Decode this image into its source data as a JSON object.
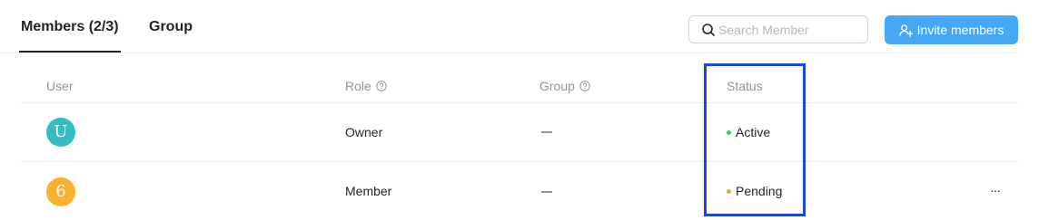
{
  "tabs": [
    {
      "label": "Members (2/3)",
      "active": true
    },
    {
      "label": "Group",
      "active": false
    }
  ],
  "search": {
    "placeholder": "Search Member",
    "value": ""
  },
  "invite": {
    "label": "Invite members"
  },
  "columns": {
    "user": "User",
    "role": "Role",
    "group": "Group",
    "status": "Status"
  },
  "rows": [
    {
      "avatar_initial": "U",
      "avatar_color": "#35bdc4",
      "role": "Owner",
      "group": "—",
      "status": "Active",
      "status_color": "#2ecc71"
    },
    {
      "avatar_initial": "6",
      "avatar_color": "#fbb12b",
      "role": "Member",
      "group": "—",
      "status": "Pending",
      "status_color": "#f5a623",
      "more": "···"
    }
  ],
  "icons": {
    "search": "search-icon",
    "invite": "add-user-icon",
    "help": "question-circle-icon",
    "more": "more-horizontal-icon"
  },
  "colors": {
    "accent": "#45a8f7",
    "highlight": "#1d48d6"
  }
}
